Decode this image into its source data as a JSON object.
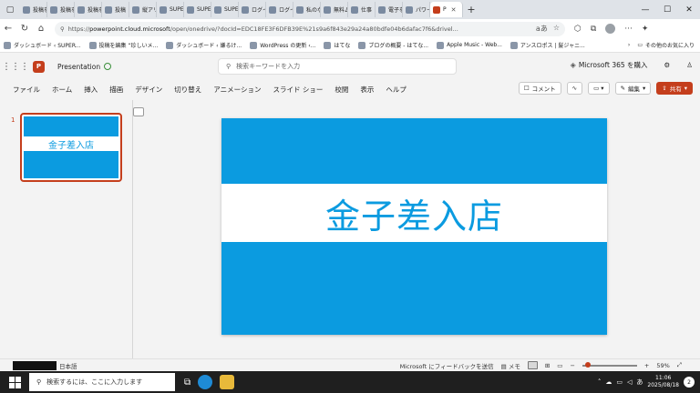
{
  "browser": {
    "tabs": [
      {
        "label": "投稿を"
      },
      {
        "label": "投稿を"
      },
      {
        "label": "投稿を"
      },
      {
        "label": "投稿"
      },
      {
        "label": "縦アリ"
      },
      {
        "label": "SUPER"
      },
      {
        "label": "SUPER"
      },
      {
        "label": "SUPER"
      },
      {
        "label": "ログイン"
      },
      {
        "label": "ログイン"
      },
      {
        "label": "私のな"
      },
      {
        "label": "無料ム"
      },
      {
        "label": "仕事"
      },
      {
        "label": "電子を"
      },
      {
        "label": "パワー"
      },
      {
        "label": "P",
        "active": true
      }
    ],
    "url_prefix": "https://",
    "url_host": "powerpoint.cloud.microsoft",
    "url_path": "/open/onedrive/?docId=EDC18FE3F6DFB39E%21s9a6f843e29a24a80bdfe04b6dafac7f6&drivel...",
    "favorites": [
      {
        "label": "ダッシュボード ‹ SUPER..."
      },
      {
        "label": "投稿を編集 “珍しいメ..."
      },
      {
        "label": "ダッシュボード ‹ 嫌るけ..."
      },
      {
        "label": "WordPress の更新 ‹..."
      },
      {
        "label": "はてな"
      },
      {
        "label": "ブログの概要 - はてな..."
      },
      {
        "label": "Apple Music - Web..."
      },
      {
        "label": "アンスロポス | 髪ジャニ..."
      }
    ],
    "favorites_other": "その他のお気に入り"
  },
  "office": {
    "doc_title": "Presentation",
    "search_placeholder": "検索キーワードを入力",
    "buy_label": "Microsoft 365 を購入",
    "ribbon_tabs": [
      "ファイル",
      "ホーム",
      "挿入",
      "描画",
      "デザイン",
      "切り替え",
      "アニメーション",
      "スライド ショー",
      "校閲",
      "表示",
      "ヘルプ"
    ],
    "comment_label": "コメント",
    "edit_label": "編集",
    "share_label": "共有"
  },
  "slides": [
    {
      "number": "1",
      "title": "金子差入店"
    }
  ],
  "current_slide": {
    "title": "金子差入店"
  },
  "statusbar": {
    "language": "日本語",
    "feedback": "Microsoft にフィードバックを送信",
    "notes": "メモ",
    "zoom": "59%",
    "zoom_fraction": 0.59
  },
  "taskbar": {
    "search_placeholder": "検索するには、ここに入力します",
    "ime": "あ",
    "time": "11:06",
    "date": "2025/08/18",
    "notifications": "2"
  },
  "colors": {
    "slide_blue": "#0b9be0",
    "accent": "#c43e1c"
  }
}
